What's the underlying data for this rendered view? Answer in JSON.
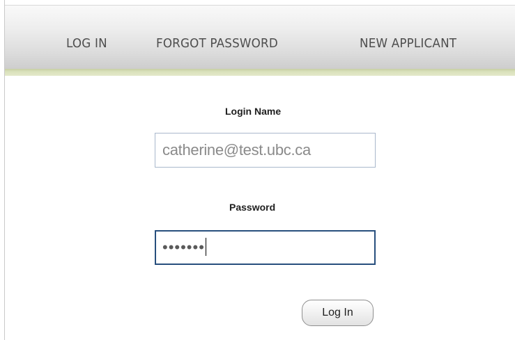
{
  "nav": {
    "log_in": "LOG IN",
    "forgot_password": "FORGOT PASSWORD",
    "new_applicant": "NEW APPLICANT"
  },
  "form": {
    "login_name_label": "Login Name",
    "login_name_value": "catherine@test.ubc.ca",
    "password_label": "Password",
    "password_masked": "•••••••",
    "submit_label": "Log In"
  },
  "colors": {
    "nav_gradient_top": "#f9f9f9",
    "nav_gradient_bottom": "#cdcdcd",
    "accent_strip": "#dbe2bd",
    "focused_border": "#274f7d",
    "input_border": "#a9b8cc"
  }
}
